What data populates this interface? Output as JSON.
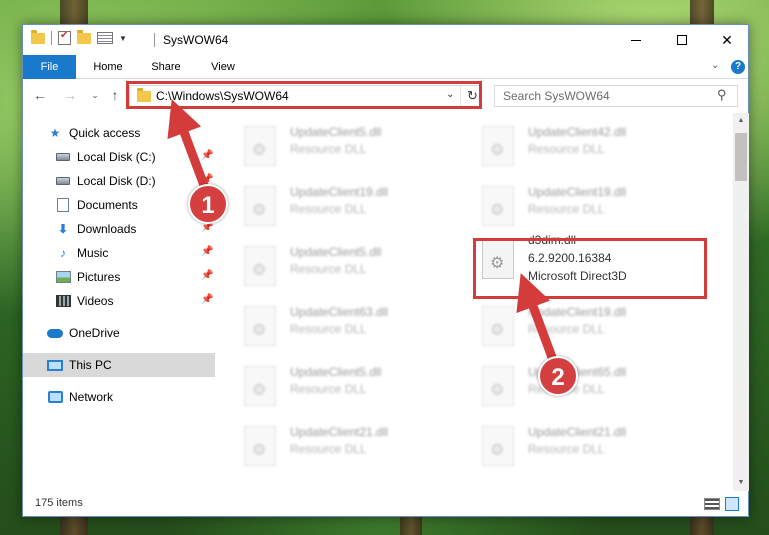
{
  "window": {
    "title": "SysWOW64",
    "minimize_icon": "minimize-icon",
    "maximize_icon": "maximize-icon",
    "close_icon": "close-icon"
  },
  "ribbon": {
    "tabs": [
      "File",
      "Home",
      "Share",
      "View"
    ],
    "expand_icon": "chevron-down-icon",
    "help_label": "?"
  },
  "address": {
    "path": "C:\\Windows\\SysWOW64",
    "refresh_icon": "refresh-icon",
    "back_icon": "←",
    "forward_icon": "→",
    "recent_icon": "⌄",
    "up_icon": "↑"
  },
  "search": {
    "placeholder": "Search SysWOW64",
    "icon": "search-icon"
  },
  "sidebar": {
    "items": [
      {
        "label": "Quick access",
        "icon": "star-icon",
        "pinned": false
      },
      {
        "label": "Local Disk (C:)",
        "icon": "drive-icon",
        "pinned": true
      },
      {
        "label": "Local Disk (D:)",
        "icon": "drive-icon",
        "pinned": true
      },
      {
        "label": "Documents",
        "icon": "documents-icon",
        "pinned": true
      },
      {
        "label": "Downloads",
        "icon": "downloads-icon",
        "pinned": true
      },
      {
        "label": "Music",
        "icon": "music-icon",
        "pinned": true
      },
      {
        "label": "Pictures",
        "icon": "pictures-icon",
        "pinned": true
      },
      {
        "label": "Videos",
        "icon": "videos-icon",
        "pinned": true
      },
      {
        "label": "OneDrive",
        "icon": "onedrive-icon",
        "pinned": false
      },
      {
        "label": "This PC",
        "icon": "pc-icon",
        "pinned": false,
        "selected": true
      },
      {
        "label": "Network",
        "icon": "network-icon",
        "pinned": false
      }
    ]
  },
  "files": {
    "left_column": [
      {
        "name": "UpdateClient5.dll",
        "desc": "Resource DLL"
      },
      {
        "name": "UpdateClient19.dll",
        "desc": "Resource DLL"
      },
      {
        "name": "UpdateClient5.dll",
        "desc": "Resource DLL"
      },
      {
        "name": "UpdateClient63.dll",
        "desc": "Resource DLL"
      },
      {
        "name": "UpdateClient5.dll",
        "desc": "Resource DLL"
      },
      {
        "name": "UpdateClient21.dll",
        "desc": "Resource DLL"
      }
    ],
    "right_column": [
      {
        "name": "UpdateClient42.dll",
        "desc": "Resource DLL"
      },
      {
        "name": "UpdateClient19.dll",
        "desc": "Resource DLL"
      },
      {
        "name": "d3dim.dll",
        "version": "6.2.9200.16384",
        "desc": "Microsoft Direct3D",
        "highlighted": true
      },
      {
        "name": "UpdateClient19.dll",
        "desc": "Resource DLL"
      },
      {
        "name": "UpdateClient65.dll",
        "desc": "Resource DLL"
      },
      {
        "name": "UpdateClient21.dll",
        "desc": "Resource DLL"
      }
    ]
  },
  "status": {
    "item_count": "175 items"
  },
  "callouts": {
    "step1": "1",
    "step2": "2",
    "color": "#d43b3b"
  },
  "colors": {
    "accent": "#1979ca",
    "highlight": "#d43b3b"
  }
}
